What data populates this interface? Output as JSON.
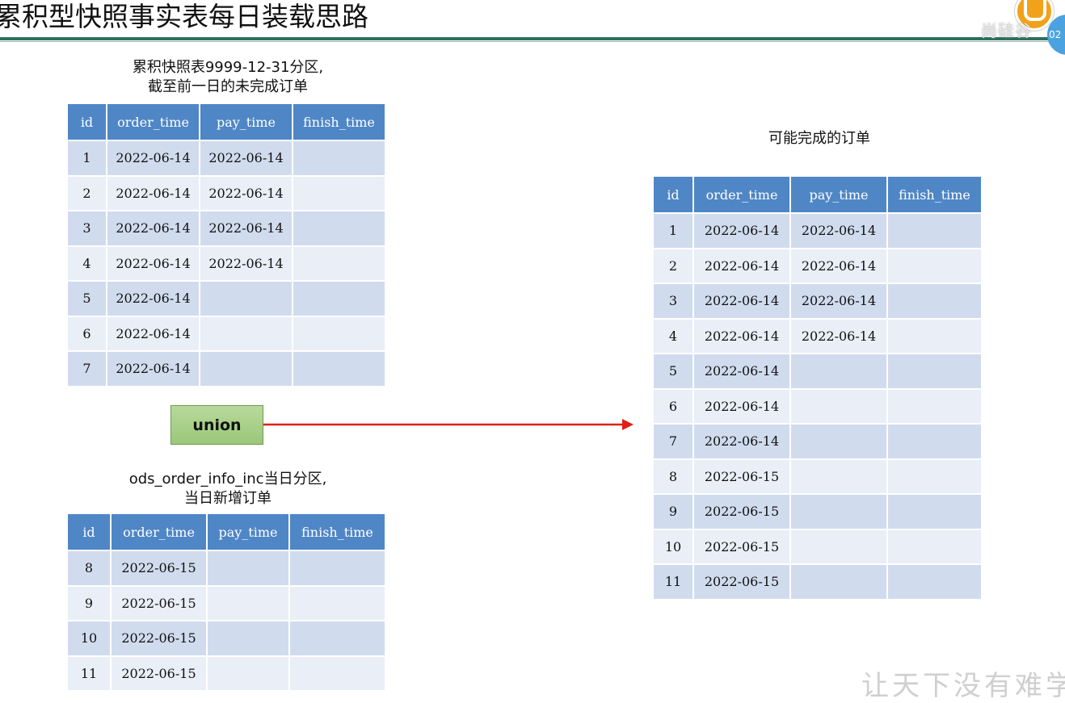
{
  "slide": {
    "title": "累积型快照事实表每日装载思路",
    "watermark": "让天下没有难学"
  },
  "logo": {
    "text": "尚硅谷",
    "number": "02"
  },
  "top_table": {
    "caption_line1": "累积快照表9999-12-31分区,",
    "caption_line2": "截至前一日的未完成订单",
    "columns": [
      "id",
      "order_time",
      "pay_time",
      "finish_time"
    ],
    "rows": [
      [
        "1",
        "2022-06-14",
        "2022-06-14",
        ""
      ],
      [
        "2",
        "2022-06-14",
        "2022-06-14",
        ""
      ],
      [
        "3",
        "2022-06-14",
        "2022-06-14",
        ""
      ],
      [
        "4",
        "2022-06-14",
        "2022-06-14",
        ""
      ],
      [
        "5",
        "2022-06-14",
        "",
        ""
      ],
      [
        "6",
        "2022-06-14",
        "",
        ""
      ],
      [
        "7",
        "2022-06-14",
        "",
        ""
      ]
    ]
  },
  "union": {
    "label": "union",
    "arrow_color": "#e02018"
  },
  "bottom_table": {
    "caption_line1": "ods_order_info_inc当日分区,",
    "caption_line2": "当日新增订单",
    "columns": [
      "id",
      "order_time",
      "pay_time",
      "finish_time"
    ],
    "rows": [
      [
        "8",
        "2022-06-15",
        "",
        ""
      ],
      [
        "9",
        "2022-06-15",
        "",
        ""
      ],
      [
        "10",
        "2022-06-15",
        "",
        ""
      ],
      [
        "11",
        "2022-06-15",
        "",
        ""
      ]
    ]
  },
  "result_table": {
    "caption": "可能完成的订单",
    "columns": [
      "id",
      "order_time",
      "pay_time",
      "finish_time"
    ],
    "rows": [
      [
        "1",
        "2022-06-14",
        "2022-06-14",
        ""
      ],
      [
        "2",
        "2022-06-14",
        "2022-06-14",
        ""
      ],
      [
        "3",
        "2022-06-14",
        "2022-06-14",
        ""
      ],
      [
        "4",
        "2022-06-14",
        "2022-06-14",
        ""
      ],
      [
        "5",
        "2022-06-14",
        "",
        ""
      ],
      [
        "6",
        "2022-06-14",
        "",
        ""
      ],
      [
        "7",
        "2022-06-14",
        "",
        ""
      ],
      [
        "8",
        "2022-06-15",
        "",
        ""
      ],
      [
        "9",
        "2022-06-15",
        "",
        ""
      ],
      [
        "10",
        "2022-06-15",
        "",
        ""
      ],
      [
        "11",
        "2022-06-15",
        "",
        ""
      ]
    ]
  },
  "colors": {
    "header_blue": "#4f86c6",
    "row_dark": "#d0dcee",
    "row_light": "#e9eef7",
    "union_green": "#a9d08e"
  }
}
